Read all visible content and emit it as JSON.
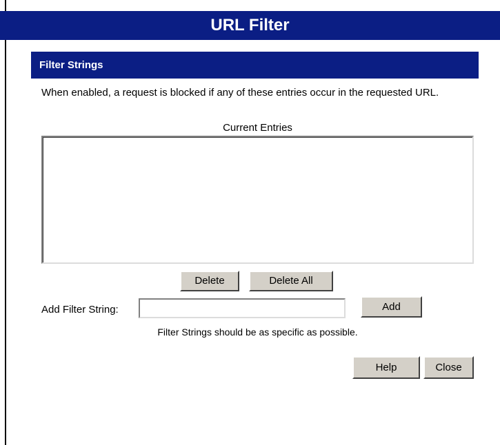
{
  "page": {
    "title": "URL Filter"
  },
  "section": {
    "title": "Filter Strings",
    "description": "When enabled, a request is blocked if any of these entries occur in the requested URL."
  },
  "entries": {
    "label": "Current Entries",
    "items": []
  },
  "buttons": {
    "delete": "Delete",
    "delete_all": "Delete All",
    "add": "Add",
    "help": "Help",
    "close": "Close"
  },
  "add_filter": {
    "label": "Add Filter String:",
    "value": "",
    "hint": "Filter Strings should be as specific as possible."
  },
  "colors": {
    "header_bg": "#0b1e84",
    "button_bg": "#d4d0c8"
  }
}
